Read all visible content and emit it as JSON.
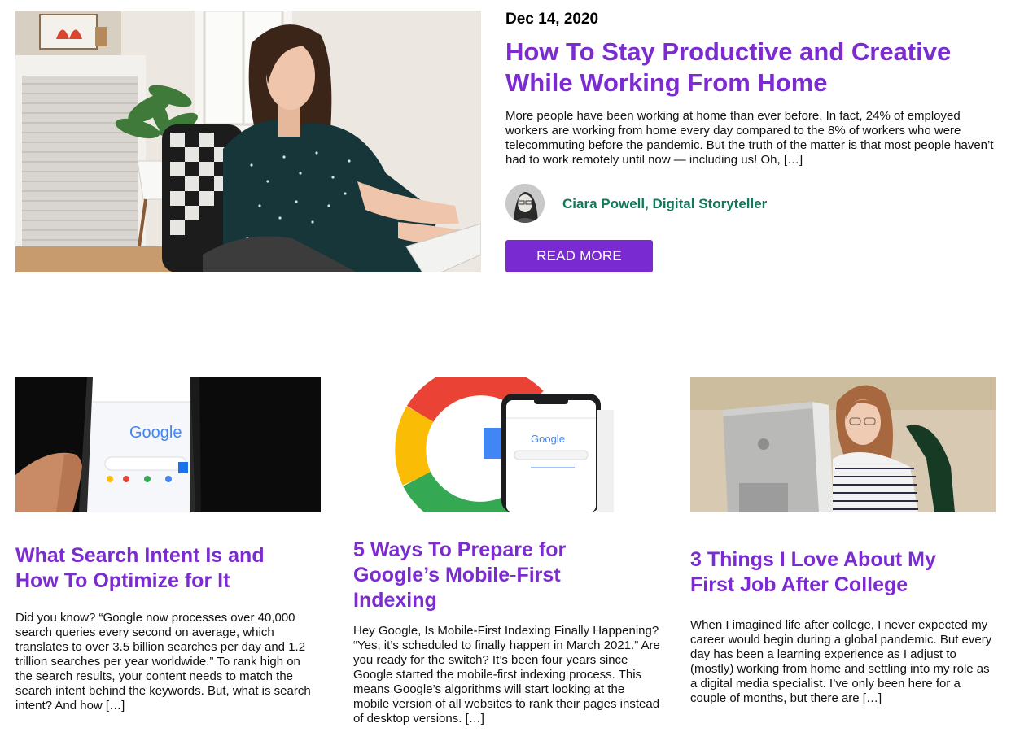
{
  "featured": {
    "date": "Dec 14, 2020",
    "title": "How To Stay Productive and Creative While Working From Home",
    "excerpt": "More people have been working at home than ever before. In fact, 24% of employed workers are working from home every day compared to the 8% of workers who were telecommuting before the pandemic. But the truth of the matter is that most people haven’t had to work remotely until now — including us! Oh, […]",
    "author": "Ciara Powell, Digital Storyteller",
    "read_more_label": "READ MORE"
  },
  "posts": [
    {
      "title": "What Search Intent Is and How To Optimize for It",
      "excerpt": "Did you know? “Google now processes over 40,000 search queries every second on average, which translates to over 3.5 billion searches per day and 1.2 trillion searches per year worldwide.” To rank high on the search results, your content needs to match the search intent behind the keywords. But, what is search intent? And how […]",
      "image_text": "Google"
    },
    {
      "title": "5 Ways To Prepare for Google’s Mobile-First Indexing",
      "excerpt": "Hey Google, Is Mobile-First Indexing Finally Happening? “Yes, it’s scheduled to finally happen in March 2021.” Are you ready for the switch? It’s been four years since Google started the mobile-first indexing process. This means Google’s algorithms will start looking at the mobile version of all websites to rank their pages instead of desktop versions. […]",
      "image_text": "Google"
    },
    {
      "title": "3 Things I Love About My First Job After College",
      "excerpt": "When I imagined life after college, I never expected my career would begin during a global pandemic. But every day has been a learning experience as I adjust to (mostly) working from home and settling into my role as a digital media specialist. I’ve only been here for a couple of months, but there are […]"
    }
  ],
  "colors": {
    "title_purple": "#7b2bd0",
    "button_purple": "#7a2ad1",
    "author_green": "#0f7a5a"
  }
}
